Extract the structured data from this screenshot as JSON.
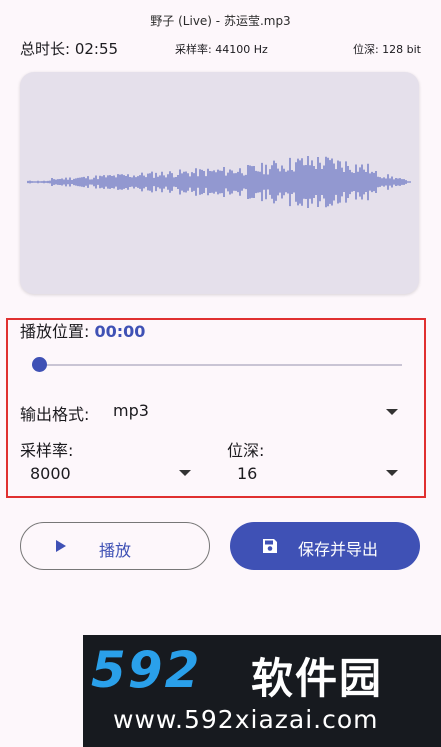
{
  "header": {
    "file_name": "野子 (Live) - 苏运莹.mp3",
    "duration_label": "总时长: 02:55",
    "sample_rate_info": "采样率: 44100 Hz",
    "bit_depth_info": "位深: 128 bit"
  },
  "player": {
    "position_label": "播放位置:",
    "position_value": "00:00",
    "slider_progress": 0
  },
  "settings": {
    "format_label": "输出格式:",
    "format_value": "mp3",
    "sample_rate_label": "采样率:",
    "sample_rate_value": "8000",
    "bit_depth_label": "位深:",
    "bit_depth_value": "16"
  },
  "actions": {
    "play_label": "播放",
    "export_label": "保存并导出"
  },
  "watermark": {
    "logo": "592",
    "site_name": "软件园",
    "url": "www.592xiazai.com"
  },
  "colors": {
    "accent": "#3f51b5",
    "waveform": "#3f51b5",
    "card_bg": "#e5e0eb",
    "highlight_border": "#e03030",
    "page_bg": "#fdf7fb"
  }
}
